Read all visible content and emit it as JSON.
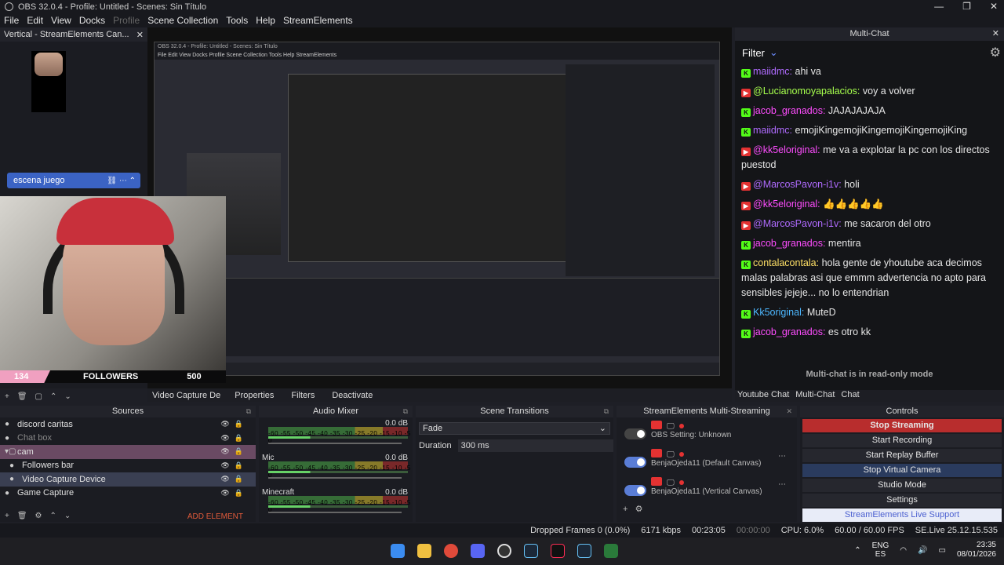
{
  "window": {
    "title": "OBS 32.0.4 - Profile: Untitled - Scenes: Sin Título",
    "minimize": "—",
    "maximize": "❐",
    "close": "✕"
  },
  "menu": {
    "items": [
      "File",
      "Edit",
      "View",
      "Docks"
    ],
    "profile": "Profile",
    "items2": [
      "Scene Collection",
      "Tools",
      "Help",
      "StreamElements"
    ]
  },
  "left_dock": {
    "title": "Vertical - StreamElements Can...",
    "scene_name": "escena juego"
  },
  "preview": {
    "nested_title": "OBS 32.0.4 - Profile: Untitled - Scenes: Sin Título",
    "nested_menu": "File  Edit  View  Docks  Profile  Scene Collection  Tools  Help  StreamElements"
  },
  "followers_bar": {
    "count": "134",
    "label": "FOLLOWERS",
    "goal": "500"
  },
  "context_bar": {
    "source": "Video Capture De",
    "properties": "Properties",
    "filters": "Filters",
    "deactivate": "Deactivate"
  },
  "multichat": {
    "title": "Multi-Chat",
    "filter": "Filter",
    "messages": [
      {
        "platform": "kk",
        "user": "maiidmc:",
        "text": "ahi va",
        "color": "#b06bff"
      },
      {
        "platform": "yt",
        "user": "@Lucianomoyapalacios:",
        "text": "voy a volver",
        "color": "#a6ff4d"
      },
      {
        "platform": "kk",
        "user": "jacob_granados:",
        "text": "JAJAJAJAJA",
        "color": "#ff4dff"
      },
      {
        "platform": "kk",
        "user": "maiidmc:",
        "text": "emojiKingemojiKingemojiKingemojiKing",
        "color": "#b06bff"
      },
      {
        "platform": "yt",
        "user": "@kk5eloriginal:",
        "text": "me va a explotar la pc con los directos puestod",
        "color": "#ff4dff"
      },
      {
        "platform": "yt",
        "user": "@MarcosPavon-i1v:",
        "text": "holi",
        "color": "#b06bff"
      },
      {
        "platform": "yt",
        "user": "@kk5eloriginal:",
        "text": "👍👍👍👍👍",
        "color": "#ff4dff"
      },
      {
        "platform": "yt",
        "user": "@MarcosPavon-i1v:",
        "text": "me sacaron del otro",
        "color": "#b06bff"
      },
      {
        "platform": "kk",
        "user": "jacob_granados:",
        "text": "mentira",
        "color": "#ff4dff"
      },
      {
        "platform": "kk",
        "user": "contalacontala:",
        "text": "hola gente de yhoutube aca decimos malas palabras asi que emmm advertencia no apto para sensibles jejeje... no lo entendrian",
        "color": "#ffe066"
      },
      {
        "platform": "kk",
        "user": "Kk5original:",
        "text": "MuteD",
        "color": "#4db8ff"
      },
      {
        "platform": "kk",
        "user": "jacob_granados:",
        "text": "es otro kk",
        "color": "#ff4dff"
      }
    ],
    "readonly": "Multi-chat is in read-only mode",
    "tabs": [
      "Youtube Chat",
      "Multi-Chat",
      "Chat"
    ]
  },
  "sources": {
    "title": "Sources",
    "items": [
      {
        "name": "discord caritas",
        "cls": ""
      },
      {
        "name": "Chat box",
        "cls": "dim"
      },
      {
        "name": "cam",
        "cls": "sel"
      },
      {
        "name": "Followers bar",
        "cls": "indent"
      },
      {
        "name": "Video Capture Device",
        "cls": "indent sel2"
      },
      {
        "name": "Game Capture",
        "cls": ""
      }
    ],
    "add_element": "ADD ELEMENT"
  },
  "audio": {
    "title": "Audio Mixer",
    "scale": "-60 -55 -50 -45 -40 -35 -30 -25 -20 -15 -10 -5 0",
    "channels": [
      {
        "name": "",
        "db": "0.0 dB"
      },
      {
        "name": "Mic",
        "db": "0.0 dB"
      },
      {
        "name": "Minecraft",
        "db": "0.0 dB"
      }
    ]
  },
  "transitions": {
    "title": "Scene Transitions",
    "selected": "Fade",
    "duration_label": "Duration",
    "duration": "300 ms"
  },
  "multistream": {
    "title": "StreamElements Multi-Streaming",
    "rows": [
      {
        "label": "OBS Setting: Unknown",
        "on": false
      },
      {
        "label": "BenjaOjeda11 (Default Canvas)",
        "on": true
      },
      {
        "label": "BenjaOjeda11 (Vertical Canvas)",
        "on": true
      }
    ]
  },
  "controls": {
    "title": "Controls",
    "stop_streaming": "Stop Streaming",
    "start_recording": "Start Recording",
    "start_replay": "Start Replay Buffer",
    "stop_vcam": "Stop Virtual Camera",
    "studio_mode": "Studio Mode",
    "settings": "Settings",
    "live_support": "StreamElements Live Support"
  },
  "status": {
    "dropped": "Dropped Frames 0 (0.0%)",
    "kbps": "6171 kbps",
    "live_time": "00:23:05",
    "rec_time": "00:00:00",
    "cpu": "CPU: 6.0%",
    "fps": "60.00 / 60.00 FPS",
    "version": "SE.Live 25.12.15.535"
  },
  "tray": {
    "lang": "ENG",
    "region": "ES",
    "time": "23:35",
    "date": "08/01/2026"
  }
}
